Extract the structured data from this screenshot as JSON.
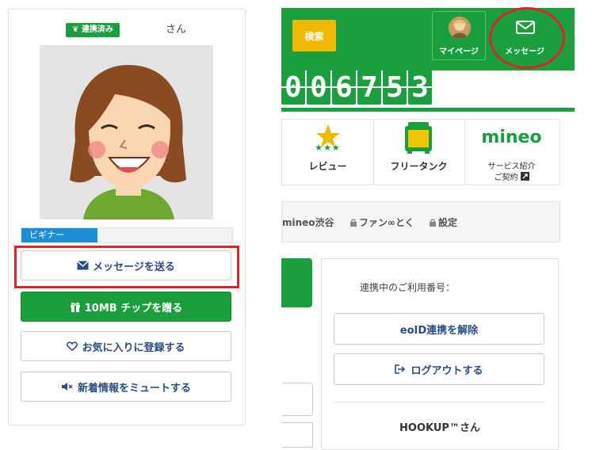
{
  "profile": {
    "linked_badge": "連携済み",
    "honorific": "さん",
    "rank": {
      "label": "ビギナー",
      "progress": 0.36
    },
    "buttons": {
      "send_message": "メッセージを送る",
      "gift_chip": "10MB チップを贈る",
      "favorite": "お気に入りに登録する",
      "mute": "新着情報をミュートする"
    }
  },
  "header": {
    "search_label": "検索",
    "mypage_label": "マイページ",
    "message_label": "メッセージ"
  },
  "counter": {
    "digits": [
      "0",
      "0",
      "6",
      "7",
      "5",
      "3"
    ]
  },
  "menu": {
    "review": "レビュー",
    "free_tank": "フリータンク",
    "brand": "mineo",
    "service_line1": "サービス紹介",
    "service_line2": "ご契約"
  },
  "breadcrumb": {
    "item1": "mineo渋谷",
    "item2": "ファン∞とく",
    "item3": "設定"
  },
  "account": {
    "linked_number_label": "連携中のご利用番号：",
    "eoid_unlink": "eoID連携を解除",
    "logout": "ログアウトする",
    "hookup_name": "HOOKUP™さん"
  },
  "colors": {
    "brand_green": "#1b9e3e",
    "search_yellow": "#f0b800",
    "rank_blue": "#1a8fd6",
    "highlight_red": "#d62828",
    "link_navy": "#2d4c7e"
  },
  "icons": {
    "send_message": "envelope-icon",
    "gift_chip": "gift-icon",
    "favorite": "heart-icon",
    "mute": "speaker-mute-icon",
    "header_message": "envelope-icon",
    "review": "star-icon",
    "free_tank": "tank-icon",
    "service": "external-link-icon",
    "breadcrumb_lock": "lock-icon",
    "logout": "logout-icon"
  }
}
